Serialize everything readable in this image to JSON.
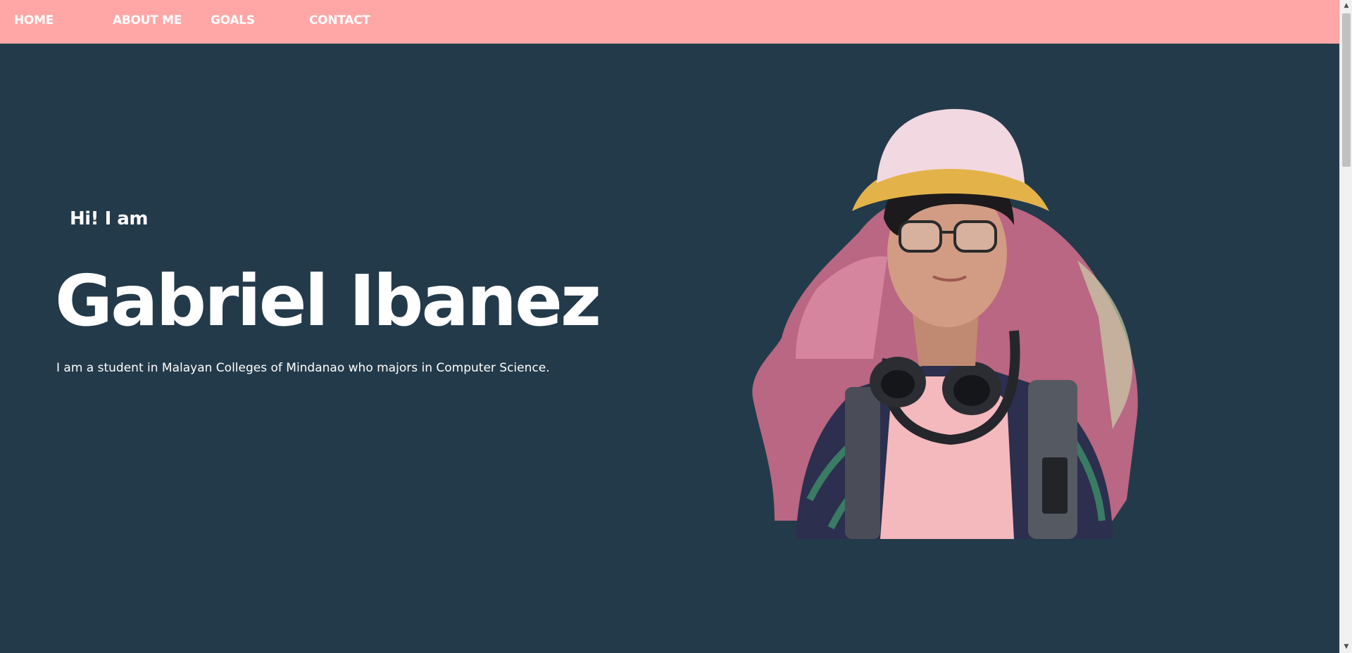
{
  "nav": {
    "items": [
      {
        "label": "HOME"
      },
      {
        "label": "ABOUT ME"
      },
      {
        "label": "GOALS"
      },
      {
        "label": "CONTACT"
      }
    ]
  },
  "hero": {
    "greeting": "Hi! I am",
    "name": "Gabriel Ibanez",
    "description": "I am a student in Malayan Colleges of Mindanao who majors in Computer Science."
  },
  "colors": {
    "nav_background": "#ffa7a7",
    "page_background": "#233a4a",
    "text": "#ffffff"
  },
  "scrollbar": {
    "up_arrow": "▲",
    "down_arrow": "▼"
  }
}
